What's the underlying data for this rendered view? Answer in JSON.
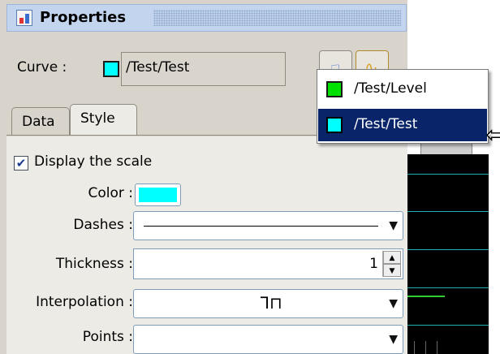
{
  "panel": {
    "title": "Properties",
    "icon": "properties-panel-icon"
  },
  "curve": {
    "label": "Curve :",
    "color": "#00ffff",
    "value": "/Test/Test",
    "select_icon": "pointer-select-icon",
    "curve_icon": "curve-chart-icon"
  },
  "tabs": [
    {
      "label": "Data",
      "active": false
    },
    {
      "label": "Style",
      "active": true
    }
  ],
  "style": {
    "display_scale": {
      "label": "Display the scale",
      "checked": true
    },
    "color": {
      "label": "Color :",
      "value": "#00ffff"
    },
    "dashes": {
      "label": "Dashes :",
      "value": "solid"
    },
    "thickness": {
      "label": "Thickness :",
      "value": "1"
    },
    "interpolation": {
      "label": "Interpolation :",
      "glyph": "⅂⊓"
    },
    "points": {
      "label": "Points :",
      "value": ""
    }
  },
  "popup_menu": {
    "items": [
      {
        "label": "/Test/Level",
        "color": "#00e000",
        "selected": false
      },
      {
        "label": "/Test/Test",
        "color": "#00ffff",
        "selected": true
      }
    ]
  },
  "chart": {
    "line_color": "#1fb0b0",
    "level_color": "#33cc33"
  }
}
